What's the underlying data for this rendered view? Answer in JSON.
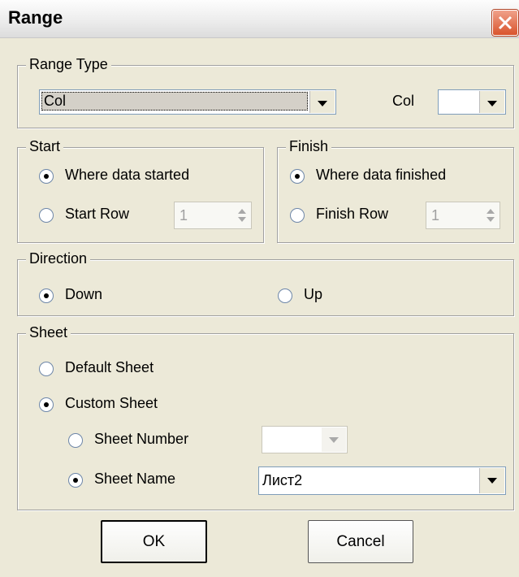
{
  "window": {
    "title": "Range",
    "close_icon": "close-icon"
  },
  "range_type": {
    "legend": "Range Type",
    "type_value": "Col",
    "col_label": "Col",
    "col_value": ""
  },
  "start": {
    "legend": "Start",
    "option_data": "Where data started",
    "option_row": "Start Row",
    "row_value": "1",
    "selected": "data"
  },
  "finish": {
    "legend": "Finish",
    "option_data": "Where data finished",
    "option_row": "Finish Row",
    "row_value": "1",
    "selected": "data"
  },
  "direction": {
    "legend": "Direction",
    "option_down": "Down",
    "option_up": "Up",
    "selected": "down"
  },
  "sheet": {
    "legend": "Sheet",
    "option_default": "Default Sheet",
    "option_custom": "Custom Sheet",
    "option_number": "Sheet Number",
    "number_value": "",
    "option_name": "Sheet Name",
    "name_value": "Лист2",
    "selected_main": "custom",
    "selected_sub": "name"
  },
  "buttons": {
    "ok": "OK",
    "cancel": "Cancel"
  }
}
